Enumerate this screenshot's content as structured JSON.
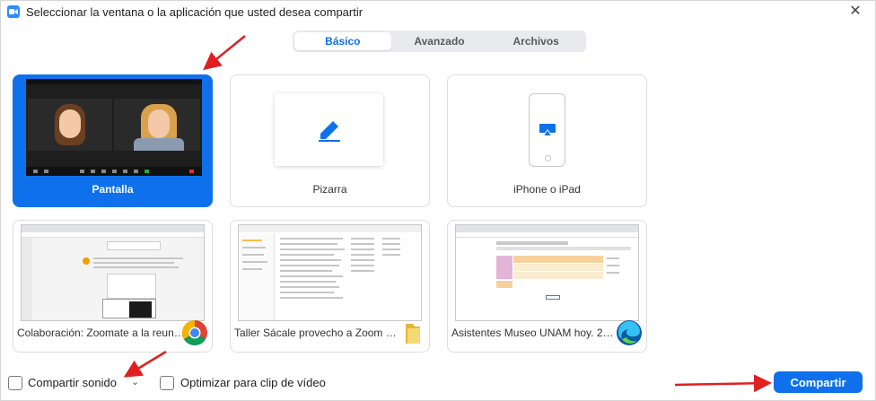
{
  "window": {
    "title": "Seleccionar la ventana o la aplicación que usted desea compartir",
    "close_glyph": "✕"
  },
  "tabs": [
    {
      "label": "Básico",
      "active": true
    },
    {
      "label": "Avanzado",
      "active": false
    },
    {
      "label": "Archivos",
      "active": false
    }
  ],
  "sources": [
    {
      "label": "Pantalla",
      "icon": "screen-thumbnail",
      "selected": true
    },
    {
      "label": "Pizarra",
      "icon": "pen-icon",
      "selected": false
    },
    {
      "label": "iPhone o iPad",
      "icon": "airplay-icon",
      "selected": false
    },
    {
      "label": "Colaboración: Zoomate a la reuni...",
      "icon": "chrome-icon",
      "selected": false
    },
    {
      "label": "Taller Sácale provecho a Zoom D...",
      "icon": "folder-icon",
      "selected": false
    },
    {
      "label": "Asistentes Museo UNAM hoy. 25 ...",
      "icon": "edge-icon",
      "selected": false
    }
  ],
  "bottom": {
    "share_sound_label": "Compartir sonido",
    "share_sound_checked": false,
    "sound_dropdown_glyph": "⌄",
    "optimize_label": "Optimizar para clip de vídeo",
    "optimize_checked": false,
    "share_button_label": "Compartir"
  },
  "colors": {
    "accent": "#0e71eb",
    "annotation_arrow": "#e02020"
  }
}
